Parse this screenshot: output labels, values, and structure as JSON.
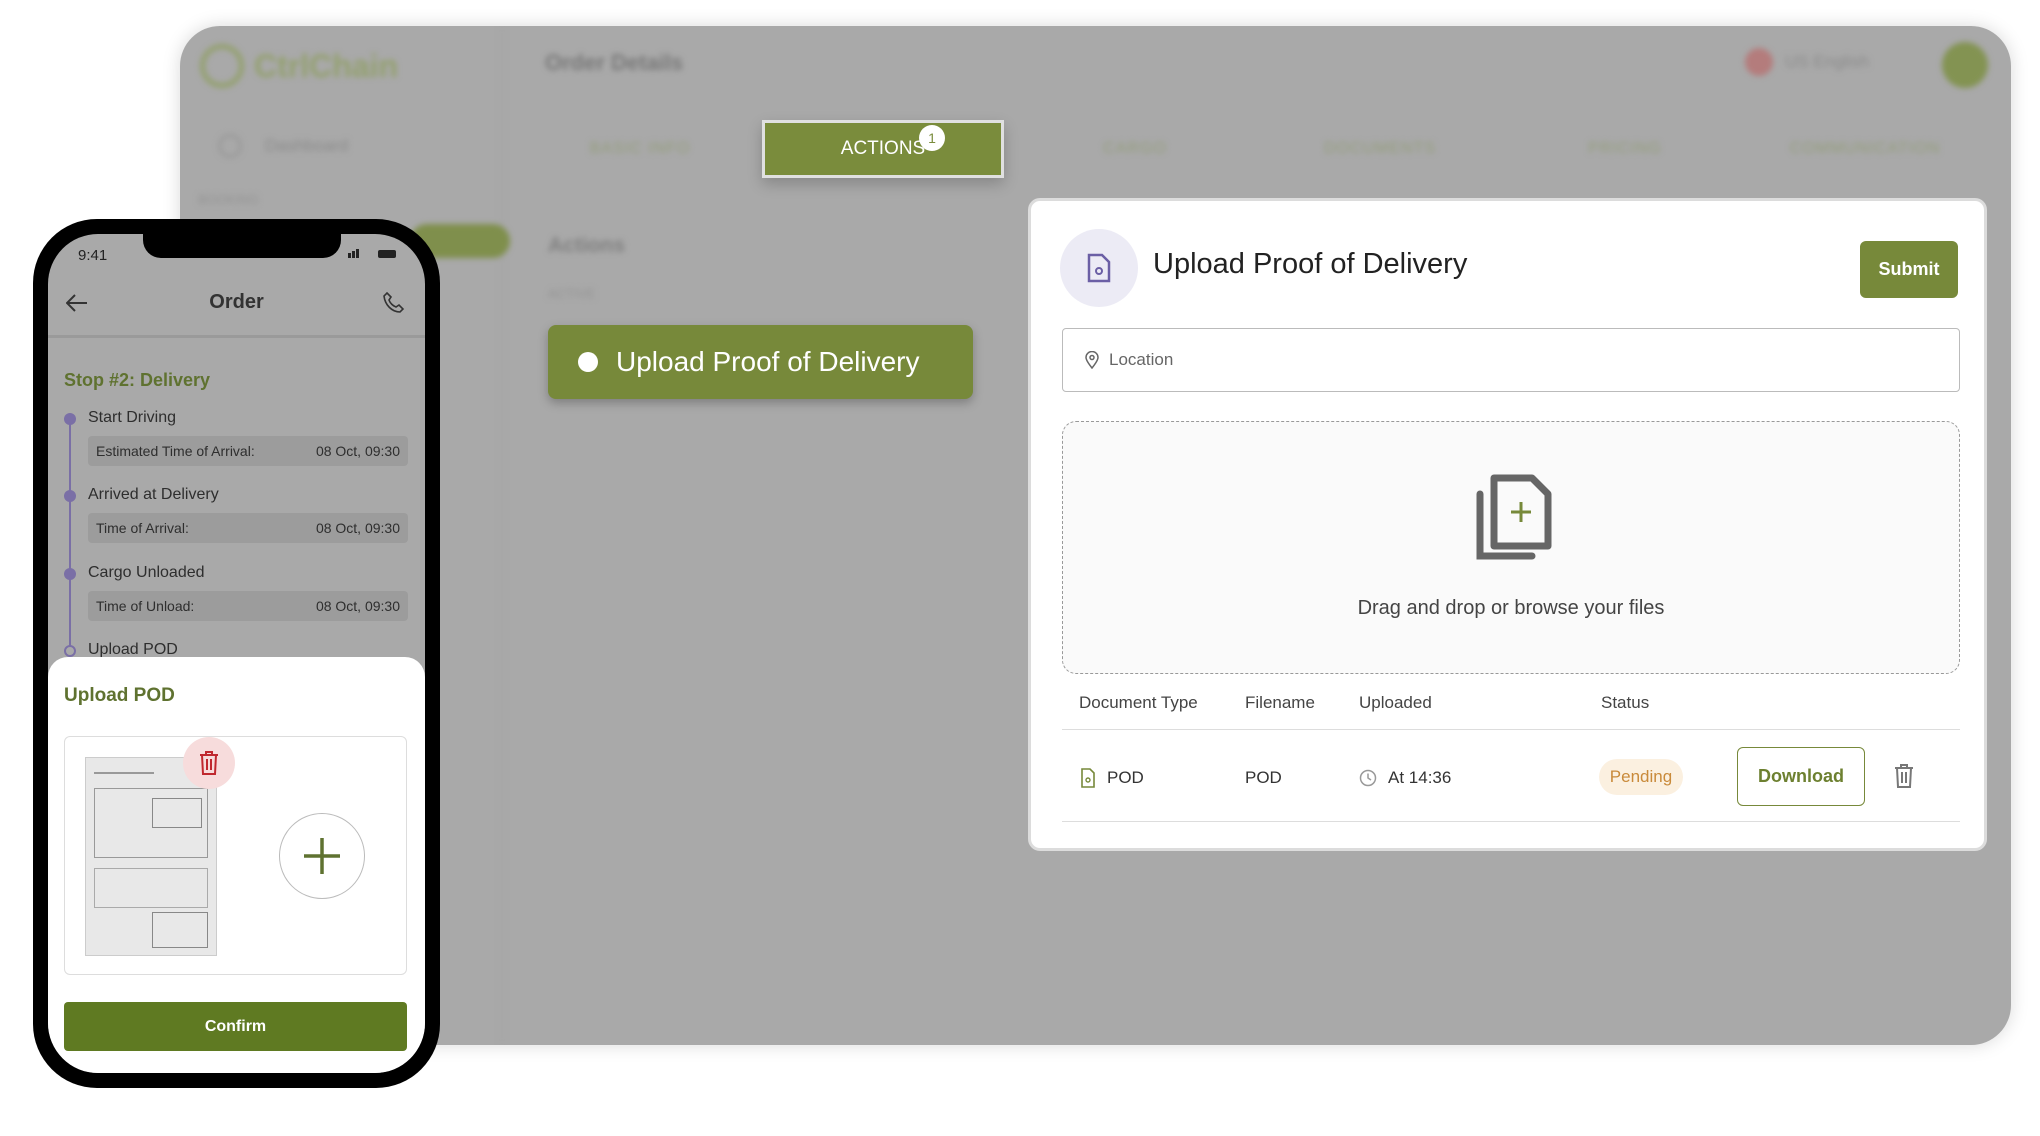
{
  "app": {
    "brand": "CtrlChain",
    "page_title": "Order Details",
    "language": "US English"
  },
  "sidebar": {
    "items": [
      "Dashboard"
    ],
    "section": "BOOKING"
  },
  "tabs": [
    {
      "label": "BASIC INFO"
    },
    {
      "label": "ACTIONS",
      "badge": "1",
      "active": true
    },
    {
      "label": "CARGO"
    },
    {
      "label": "DOCUMENTS"
    },
    {
      "label": "PRICING"
    },
    {
      "label": "COMMUNICATION"
    }
  ],
  "actions": {
    "title": "Actions",
    "section": "ACTIVE",
    "action_button": "Upload Proof of Delivery"
  },
  "modal": {
    "title": "Upload Proof of Delivery",
    "submit": "Submit",
    "location_placeholder": "Location",
    "dropzone_text": "Drag and drop or browse your files",
    "columns": [
      "Document Type",
      "Filename",
      "Uploaded",
      "Status"
    ],
    "rows": [
      {
        "type": "POD",
        "filename": "POD",
        "uploaded": "At 14:36",
        "status": "Pending",
        "download": "Download"
      }
    ]
  },
  "phone": {
    "time": "9:41",
    "title": "Order",
    "stop_title": "Stop #2: Delivery",
    "timeline": [
      {
        "label": "Start Driving",
        "detail_label": "Estimated Time of Arrival:",
        "detail_value": "08 Oct, 09:30"
      },
      {
        "label": "Arrived at Delivery",
        "detail_label": "Time of Arrival:",
        "detail_value": "08 Oct, 09:30"
      },
      {
        "label": "Cargo Unloaded",
        "detail_label": "Time of Unload:",
        "detail_value": "08 Oct, 09:30"
      },
      {
        "label": "Upload POD"
      }
    ],
    "sheet_title": "Upload POD",
    "confirm": "Confirm"
  },
  "colors": {
    "accent": "#77893a",
    "pending_bg": "#fbf0e0",
    "pending_text": "#c98a3a",
    "timeline": "#7a6fa6"
  }
}
